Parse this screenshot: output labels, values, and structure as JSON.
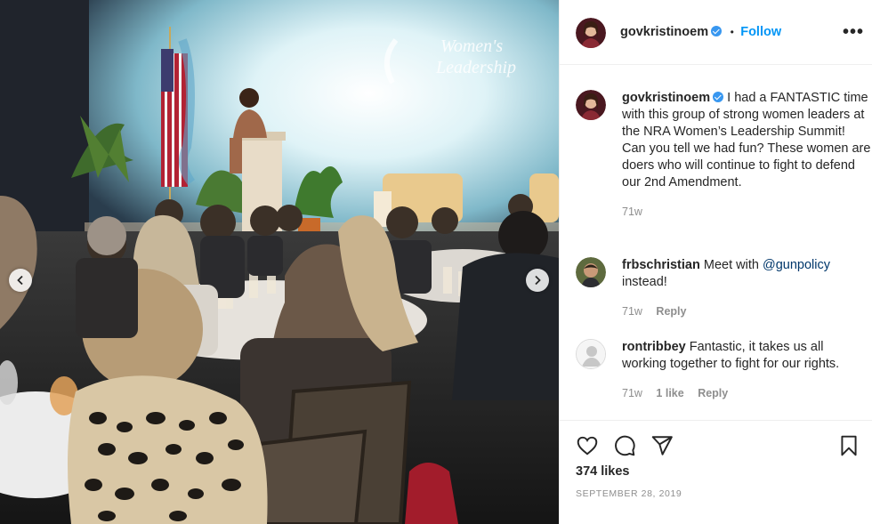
{
  "post": {
    "nav_prev_icon": "chevron-left-icon",
    "nav_next_icon": "chevron-right-icon",
    "banner_text_line1": "Women's",
    "banner_text_line2": "Leadership"
  },
  "header": {
    "username": "govkristinoem",
    "separator": "•",
    "follow_label": "Follow",
    "more_icon": "more-options-icon",
    "more_label": "•••"
  },
  "caption": {
    "username": "govkristinoem",
    "text": "I had a FANTASTIC time with this group of strong women leaders at the NRA Women’s Leadership Summit! Can you tell we had fun? These women are doers who will continue to fight to defend our 2nd Amendment.",
    "time": "71w"
  },
  "comments": [
    {
      "username": "frbschristian",
      "text_before": "Meet with ",
      "mention": "@gunpolicy",
      "text_after": "instead!",
      "time": "71w",
      "reply_label": "Reply"
    },
    {
      "username": "rontribbey",
      "text": "Fantastic, it takes us all working together to fight for our rights.",
      "time": "71w",
      "likes": "1 like",
      "reply_label": "Reply"
    }
  ],
  "actions": {
    "like_icon": "heart-icon",
    "comment_icon": "comment-icon",
    "share_icon": "share-icon",
    "save_icon": "bookmark-icon",
    "likes_count": "374 likes",
    "date": "SEPTEMBER 28, 2019"
  },
  "colors": {
    "accent": "#0095f6",
    "verified": "#3897f0",
    "muted": "#8e8e8e",
    "mention": "#00376b"
  }
}
